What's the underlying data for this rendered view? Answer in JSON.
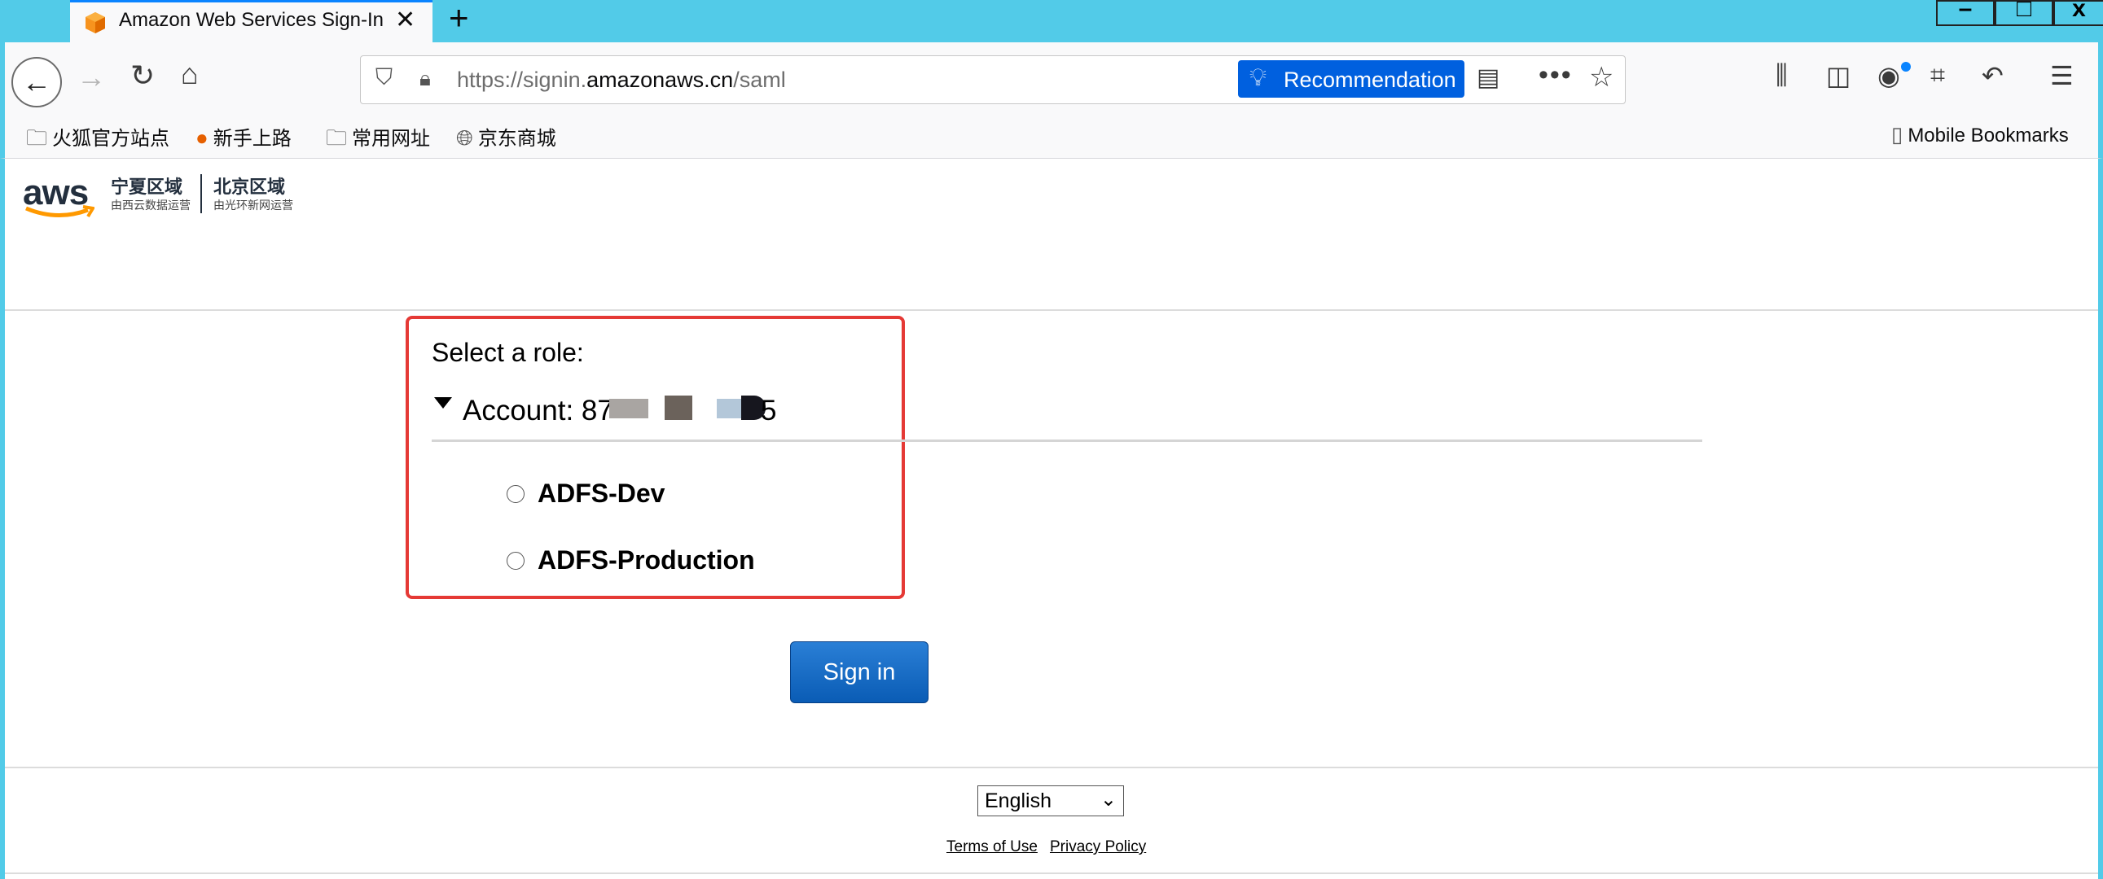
{
  "browser": {
    "tab_title": "Amazon Web Services Sign-In",
    "tab_close": "✕",
    "new_tab": "+",
    "window_buttons": {
      "minimize": "–",
      "maximize": "□",
      "close": "x"
    },
    "url_prefix": "https://signin.",
    "url_domain": "amazonaws.cn",
    "url_path": "/saml",
    "recommendation_label": "Recommendation",
    "bookmarks": [
      "火狐官方站点",
      "新手上路",
      "常用网址",
      "京东商城"
    ],
    "mobile_bookmarks": "Mobile Bookmarks",
    "accent_color": "#52cbe8"
  },
  "header": {
    "logo_text": "aws",
    "region1_title": "宁夏区域",
    "region1_sub": "由西云数据运营",
    "region2_title": "北京区域",
    "region2_sub": "由光环新网运营"
  },
  "main": {
    "select_role_label": "Select a role:",
    "account_label": "Account: 87",
    "account_suffix": "5",
    "roles": [
      "ADFS-Dev",
      "ADFS-Production"
    ],
    "sign_in_label": "Sign in"
  },
  "footer": {
    "language": "English",
    "terms": "Terms of Use",
    "privacy": "Privacy Policy"
  }
}
